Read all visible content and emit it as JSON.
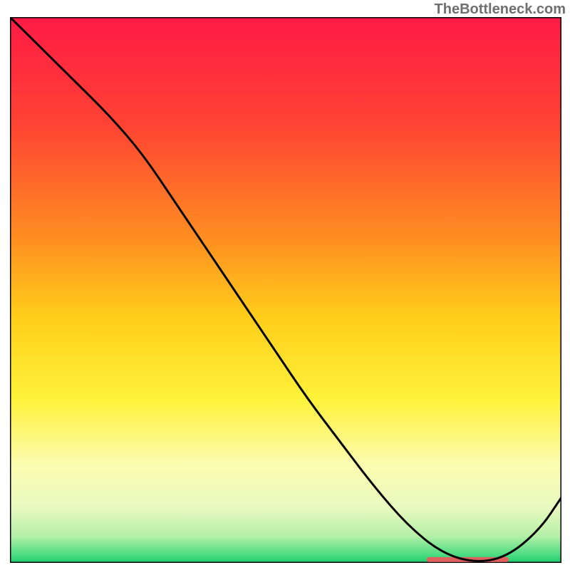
{
  "watermark": "TheBottleneck.com",
  "chart_data": {
    "type": "line",
    "title": "",
    "xlabel": "",
    "ylabel": "",
    "xlim": [
      0,
      100
    ],
    "ylim": [
      0,
      100
    ],
    "x": [
      0,
      6,
      12,
      18,
      24,
      30,
      36,
      42,
      48,
      54,
      60,
      66,
      72,
      78,
      84,
      90,
      96,
      100
    ],
    "values": [
      100,
      94,
      88,
      82,
      75,
      66,
      57,
      48,
      39,
      30,
      22,
      14,
      7,
      2,
      0,
      1,
      6,
      12
    ],
    "background_gradient": {
      "stops": [
        {
          "offset": 0.0,
          "color": "#ff1a46"
        },
        {
          "offset": 0.2,
          "color": "#ff4433"
        },
        {
          "offset": 0.4,
          "color": "#ff8c22"
        },
        {
          "offset": 0.55,
          "color": "#ffce1a"
        },
        {
          "offset": 0.7,
          "color": "#fff23a"
        },
        {
          "offset": 0.82,
          "color": "#fcfcb0"
        },
        {
          "offset": 0.9,
          "color": "#e8f9c0"
        },
        {
          "offset": 0.95,
          "color": "#b6f0a8"
        },
        {
          "offset": 0.985,
          "color": "#4cdc82"
        },
        {
          "offset": 1.0,
          "color": "#1fc96b"
        }
      ]
    },
    "marker": {
      "x_start": 76,
      "x_end": 90,
      "y": 0.6,
      "color": "#e0605d"
    }
  }
}
